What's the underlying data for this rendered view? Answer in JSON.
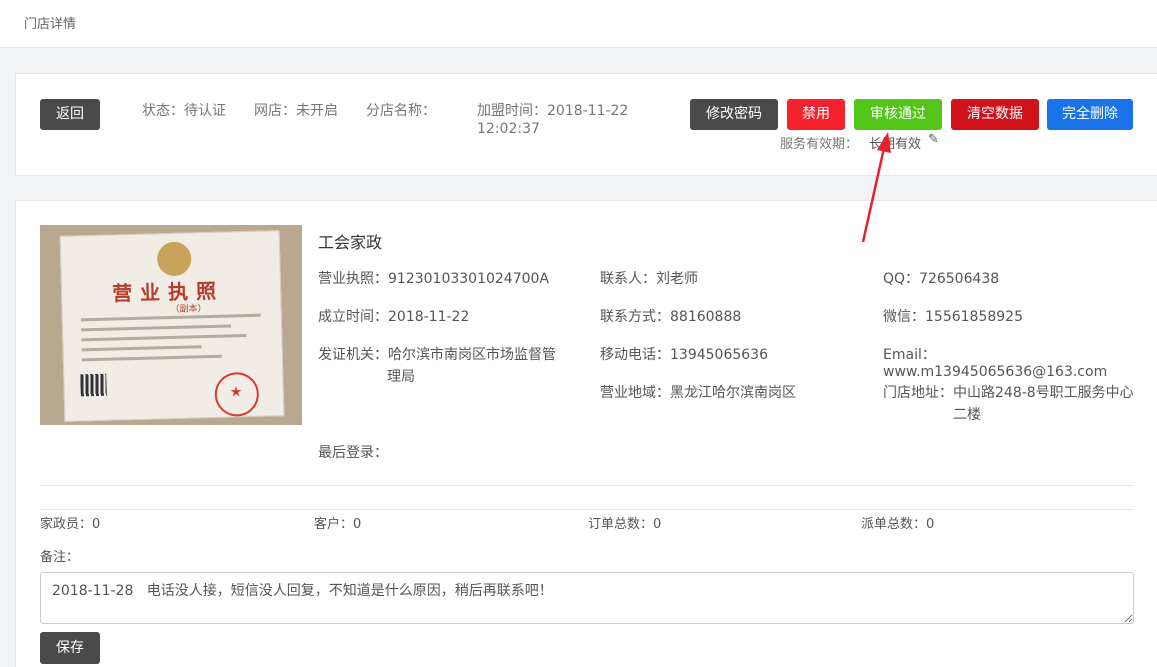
{
  "topbar": {
    "breadcrumb": "门店详情"
  },
  "header": {
    "back_label": "返回",
    "status": "状态：待认证",
    "online_store": "网店：未开启",
    "branch_name": "分店名称：",
    "join_time_line1": "加盟时间：2018-11-22",
    "join_time_line2": "12:02:37",
    "actions": {
      "change_password": "修改密码",
      "disable": "禁用",
      "approve": "审核通过",
      "clear_data": "清空数据",
      "delete_all": "完全删除"
    },
    "service_validity_label": "服务有效期：",
    "service_validity_value": "长期有效"
  },
  "store": {
    "name": "工会家政",
    "license": "营业执照：91230103301024700A",
    "founded": "成立时间：2018-11-22",
    "issuer_line1": "发证机关：哈尔滨市南岗区市场监督管",
    "issuer_line2": "理局",
    "last_login": "最后登录：",
    "contact": "联系人：刘老师",
    "phone": "联系方式：88160888",
    "mobile": "移动电话：13945065636",
    "region": "营业地域：黑龙江哈尔滨南岗区",
    "qq": "QQ：726506438",
    "wechat": "微信：15561858925",
    "email": "Email：www.m13945065636@163.com",
    "address_label": "门店地址：",
    "address_line1": "中山路248-8号职工服务中心",
    "address_line2": "二楼"
  },
  "license_image": {
    "title": "营业执照",
    "subtitle": "（副本）"
  },
  "stats": {
    "housekeepers": "家政员：0",
    "customers": "客户：0",
    "orders": "订单总数：0",
    "dispatches": "派单总数：0"
  },
  "remark": {
    "label": "备注：",
    "value": "2018-11-28   电话没人接，短信没人回复，不知道是什么原因，稍后再联系吧！",
    "save_label": "保存"
  },
  "colors": {
    "dark": "#4a4a4a",
    "red": "#f5222d",
    "green": "#52c41a",
    "crimson": "#d0121b",
    "blue": "#1a73e8",
    "annotation_arrow": "#e8202a"
  }
}
